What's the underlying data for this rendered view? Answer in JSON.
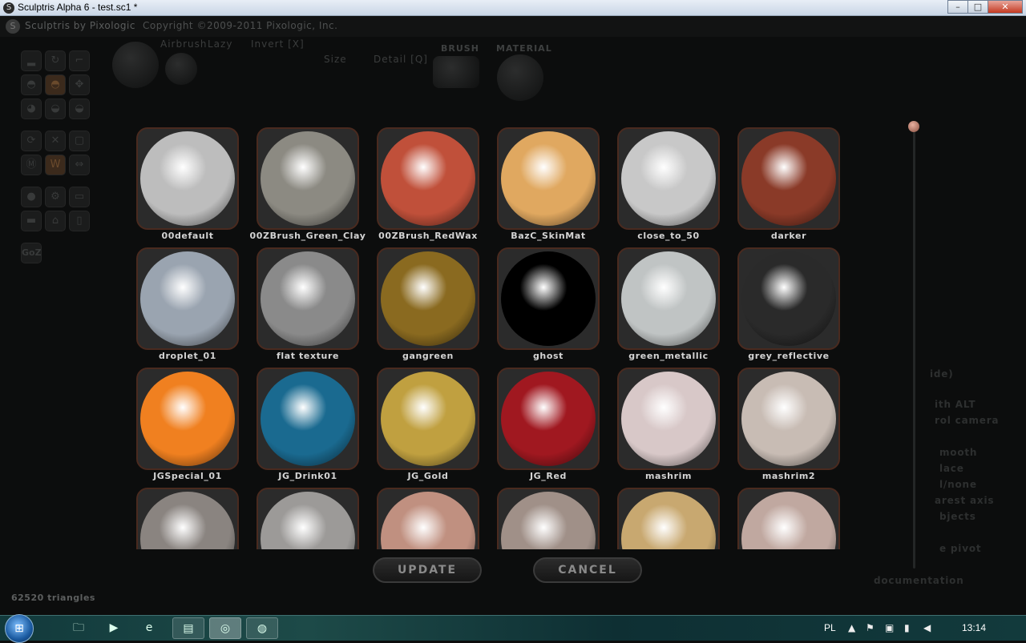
{
  "window": {
    "title": "Sculptris Alpha 6 - test.sc1 *",
    "minimize": "–",
    "maximize": "□",
    "close": "✕"
  },
  "app_header": {
    "brand": "Sculptris by Pixologic",
    "copyright": "Copyright ©2009-2011 Pixologic, Inc."
  },
  "toolbar": {
    "airbrush": "Airbrush",
    "lazy": "Lazy",
    "invert": "Invert [X]",
    "size": "Size",
    "detail": "Detail [Q]",
    "brush": "BRUSH",
    "material": "MATERIAL"
  },
  "side_panel": {
    "goz": "GoZ",
    "items": [
      "ide)",
      "ith ALT",
      "rol camera",
      "mooth",
      "lace",
      "l/none",
      "arest axis",
      "bjects",
      "e pivot",
      "documentation"
    ]
  },
  "materials": [
    {
      "name": "00default",
      "color": "#bdbdbd"
    },
    {
      "name": "00ZBrush_Green_Clay",
      "color": "#8c8a82"
    },
    {
      "name": "00ZBrush_RedWax",
      "color": "#c0503a"
    },
    {
      "name": "BazC_SkinMat",
      "color": "#e0a860"
    },
    {
      "name": "close_to_50",
      "color": "#c8c8c8"
    },
    {
      "name": "darker",
      "color": "#8a3a28"
    },
    {
      "name": "droplet_01",
      "color": "#9aa4b0"
    },
    {
      "name": "flat texture",
      "color": "#8a8a8a"
    },
    {
      "name": "gangreen",
      "color": "#8a6a20"
    },
    {
      "name": "ghost",
      "color": "#000000"
    },
    {
      "name": "green_metallic",
      "color": "#c0c4c4"
    },
    {
      "name": "grey_reflective",
      "color": "#2a2a2a"
    },
    {
      "name": "JGSpecial_01",
      "color": "#f08020"
    },
    {
      "name": "JG_Drink01",
      "color": "#1a6a90"
    },
    {
      "name": "JG_Gold",
      "color": "#c0a040"
    },
    {
      "name": "JG_Red",
      "color": "#a01820"
    },
    {
      "name": "mashrim",
      "color": "#d8c8c8"
    },
    {
      "name": "mashrim2",
      "color": "#c8bcb4"
    },
    {
      "name": "",
      "color": "#8a8480"
    },
    {
      "name": "",
      "color": "#9c9a98"
    },
    {
      "name": "",
      "color": "#c09080"
    },
    {
      "name": "",
      "color": "#a09088"
    },
    {
      "name": "",
      "color": "#c8a870"
    },
    {
      "name": "",
      "color": "#c0a8a0"
    }
  ],
  "dialog": {
    "update": "UPDATE",
    "cancel": "CANCEL"
  },
  "status": {
    "triangles": "62520 triangles"
  },
  "taskbar": {
    "language": "PL",
    "time": "13:14"
  }
}
